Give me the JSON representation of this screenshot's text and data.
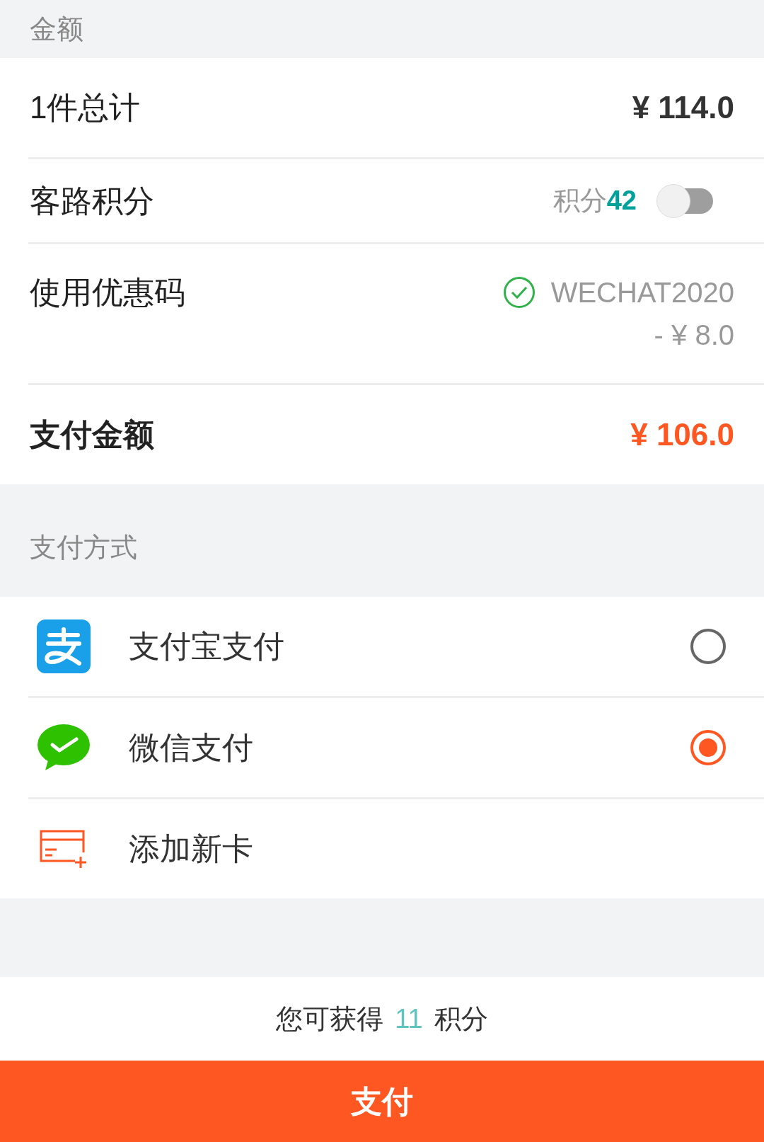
{
  "amount_section": {
    "title": "金额"
  },
  "rows": [
    {
      "kind": "total",
      "label": "1件总计",
      "value": "¥ 114.0"
    },
    {
      "kind": "points",
      "label": "客路积分",
      "points_label": "积分",
      "points": "42",
      "on": false
    },
    {
      "kind": "coupon",
      "label": "使用优惠码",
      "code": "WECHAT2020",
      "discount": "- ¥ 8.0",
      "applied": true
    },
    {
      "kind": "pay_total",
      "label": "支付金额",
      "value": "¥ 106.0"
    }
  ],
  "payment_section": {
    "title": "支付方式"
  },
  "methods": [
    {
      "kind": "alipay",
      "label": "支付宝支付",
      "selected": false
    },
    {
      "kind": "wechat",
      "label": "微信支付",
      "selected": true
    },
    {
      "kind": "add_card",
      "label": "添加新卡"
    }
  ],
  "reward": {
    "prefix": "您可获得",
    "points": "11",
    "suffix": "积分"
  },
  "pay_button": {
    "label": "支付"
  }
}
